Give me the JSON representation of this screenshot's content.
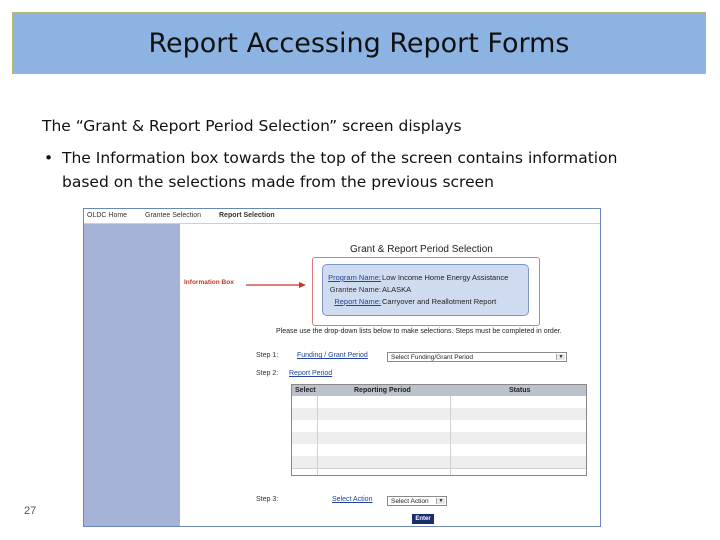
{
  "slide": {
    "title": "Report Accessing Report Forms",
    "intro": "The “Grant & Report Period Selection” screen displays",
    "bullet_marker": "•",
    "bullet": "The Information box towards the top of the screen contains information based on the selections made from the previous screen",
    "page_number": "27"
  },
  "app": {
    "nav": [
      "OLDC Home",
      "Grantee Selection",
      "Report Selection"
    ],
    "section_title": "Grant & Report Period Selection",
    "info_box_callout": "Information Box",
    "info": [
      {
        "label": "Program Name:",
        "value": "Low Income Home Energy Assistance"
      },
      {
        "label": "Grantee Name:",
        "value": "ALASKA"
      },
      {
        "label": "Report Name:",
        "value": "Carryover and Reallotment Report"
      }
    ],
    "instructions": "Please use the drop-down lists below to make selections. Steps must be completed in order.",
    "steps": [
      {
        "label": "Step 1:",
        "link": "Funding / Grant Period",
        "select_value": "Select Funding/Grant Period"
      },
      {
        "label": "Step 2:",
        "link": "Report Period"
      },
      {
        "label": "Step 3:",
        "link": "Select Action",
        "select_value": "Select Action"
      }
    ],
    "table_headers": [
      "Select",
      "Reporting Period",
      "Status"
    ],
    "enter_button": "Enter"
  }
}
